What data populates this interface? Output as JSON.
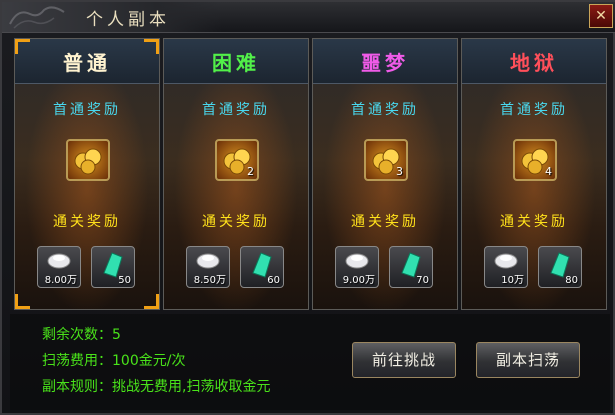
{
  "title": "个人副本",
  "close_icon_text": "✕",
  "first_reward_label": "首通奖励",
  "clear_reward_label": "通关奖励",
  "cards": [
    {
      "name": "普通",
      "color": "#fff3d0",
      "gold_count": "",
      "silver": "8.00万",
      "jade": "50",
      "selected": true
    },
    {
      "name": "困难",
      "color": "#52f049",
      "gold_count": "2",
      "silver": "8.50万",
      "jade": "60",
      "selected": false
    },
    {
      "name": "噩梦",
      "color": "#f05be8",
      "gold_count": "3",
      "silver": "9.00万",
      "jade": "70",
      "selected": false
    },
    {
      "name": "地狱",
      "color": "#ff4f5a",
      "gold_count": "4",
      "silver": "10万",
      "jade": "80",
      "selected": false
    }
  ],
  "info": {
    "remaining": "剩余次数：5",
    "sweep_cost": "扫荡费用：100金元/次",
    "rules": "副本规则：挑战无费用,扫荡收取金元"
  },
  "buttons": {
    "challenge": "前往挑战",
    "sweep": "副本扫荡"
  }
}
